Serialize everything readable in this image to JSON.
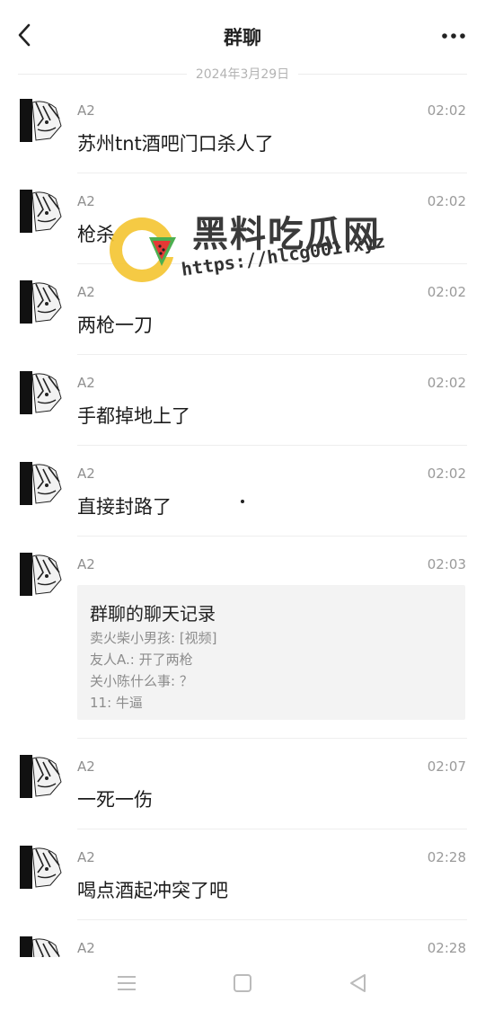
{
  "header": {
    "title": "群聊"
  },
  "date_separator": "2024年3月29日",
  "messages": [
    {
      "sender": "A2",
      "time": "02:02",
      "text": "苏州tnt酒吧门口杀人了"
    },
    {
      "sender": "A2",
      "time": "02:02",
      "text": "枪杀"
    },
    {
      "sender": "A2",
      "time": "02:02",
      "text": "两枪一刀"
    },
    {
      "sender": "A2",
      "time": "02:02",
      "text": "手都掉地上了"
    },
    {
      "sender": "A2",
      "time": "02:02",
      "text": "直接封路了"
    },
    {
      "sender": "A2",
      "time": "02:03",
      "card": {
        "title": "群聊的聊天记录",
        "lines": [
          "卖火柴小男孩: [视频]",
          "友人A.: 开了两枪",
          "关小陈什么事: ？",
          "11: 牛逼"
        ]
      }
    },
    {
      "sender": "A2",
      "time": "02:07",
      "text": "一死一伤"
    },
    {
      "sender": "A2",
      "time": "02:28",
      "text": "喝点酒起冲突了吧"
    },
    {
      "sender": "A2",
      "time": "02:28",
      "text": ""
    }
  ],
  "watermark": {
    "title": "黑料吃瓜网",
    "url": "https://hlcg001.xyz"
  },
  "icons": {
    "back": "chevron-left-icon",
    "more": "more-horizontal-icon",
    "nav_menu": "menu-icon",
    "nav_home": "square-icon",
    "nav_back": "triangle-back-icon"
  },
  "colors": {
    "background": "#ffffff",
    "card": "#f3f3f3",
    "meta_text": "#9a9a9a",
    "watermark_yellow": "#f4c430"
  }
}
